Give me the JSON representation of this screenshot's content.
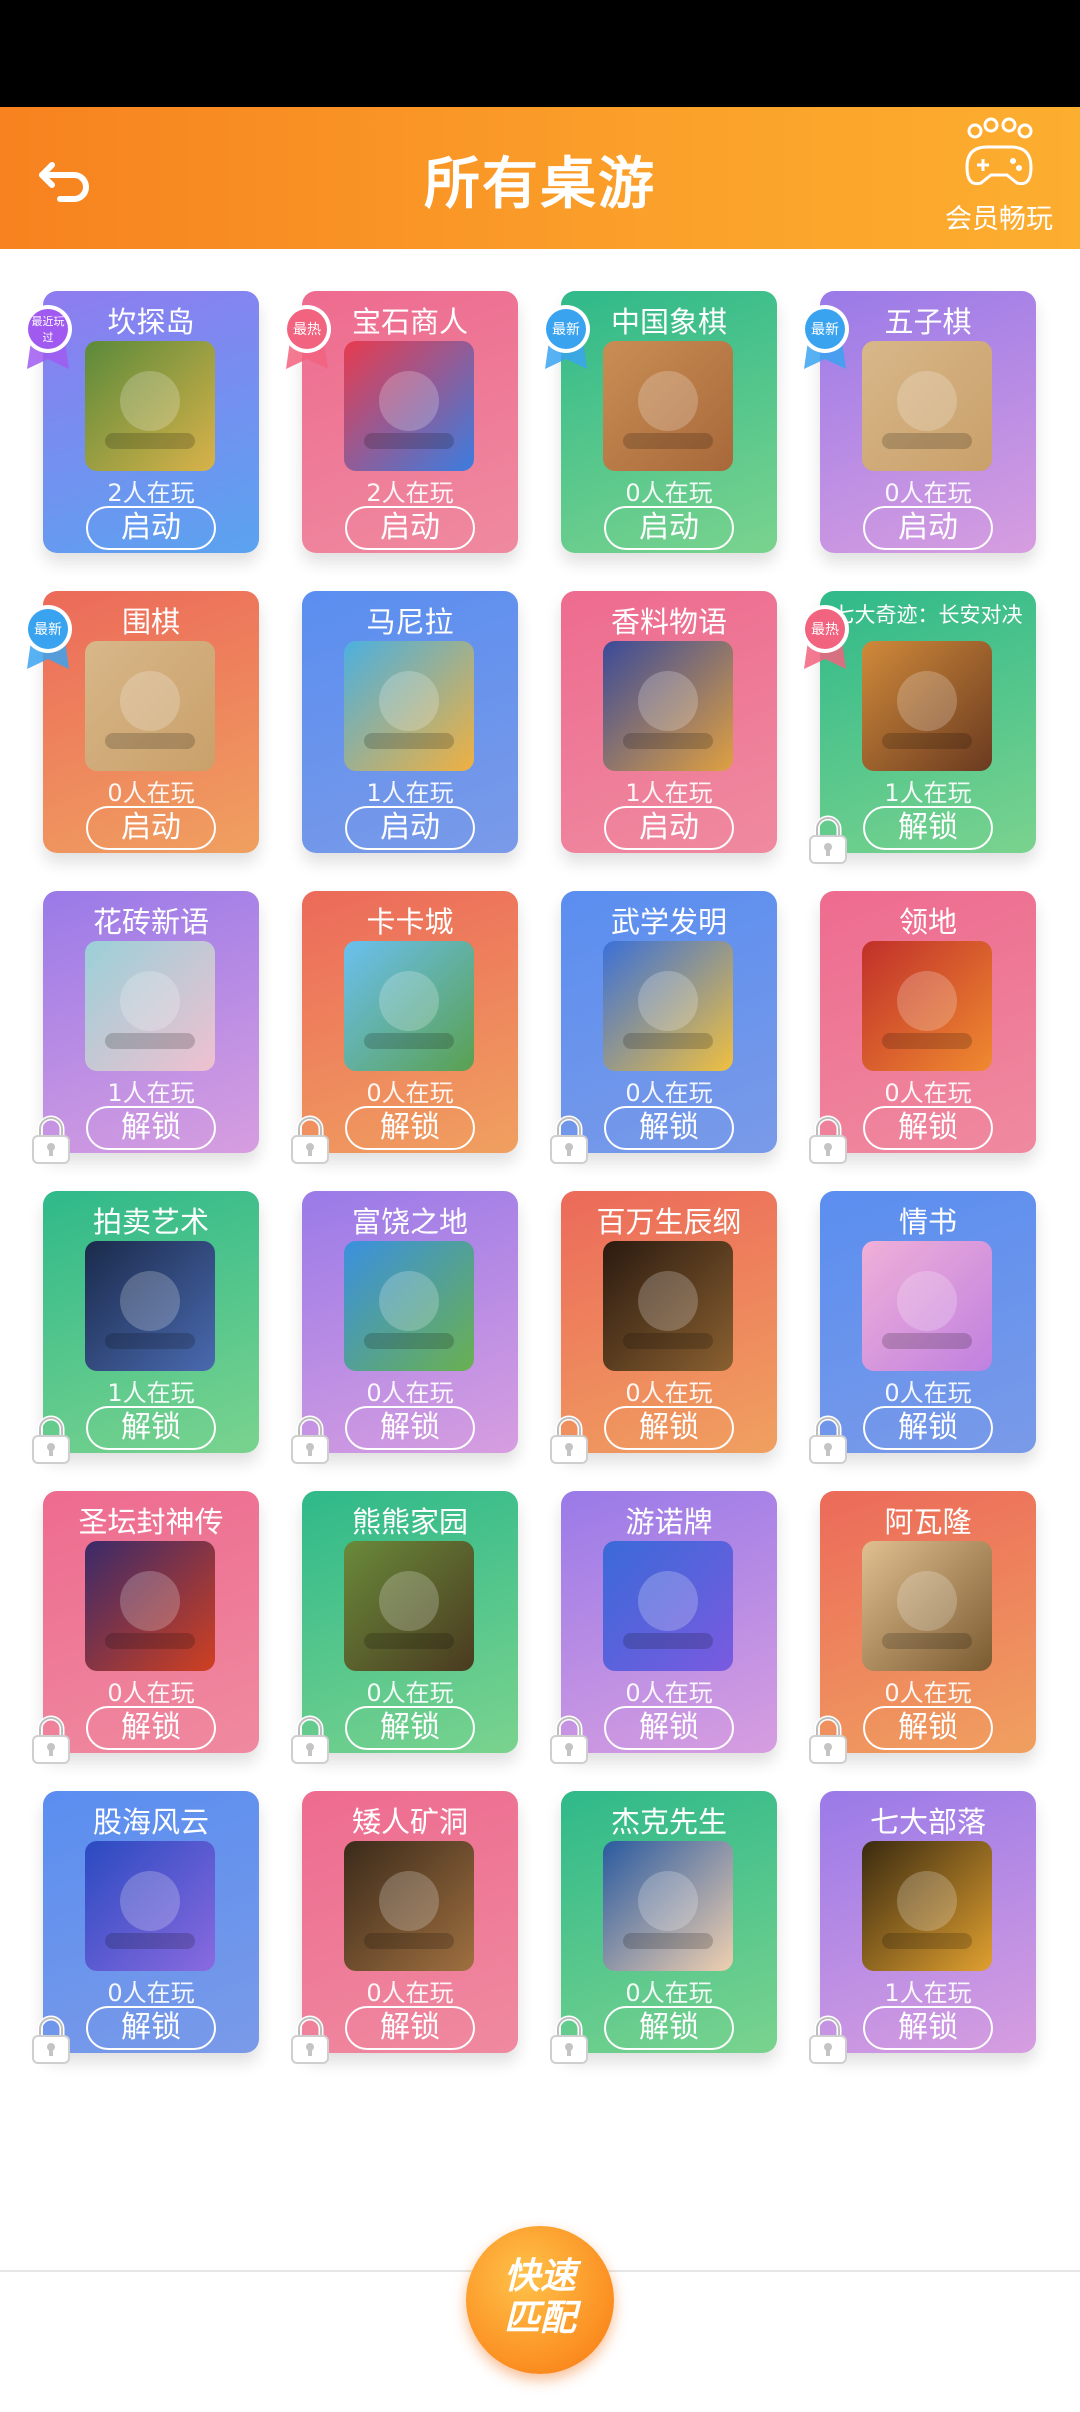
{
  "header": {
    "title": "所有桌游",
    "vip_label": "会员畅玩"
  },
  "bottom": {
    "match_line1": "快速",
    "match_line2": "匹配"
  },
  "games": [
    {
      "name": "坎探岛",
      "players": "2人在玩",
      "action": "启动",
      "badge": "最近玩过",
      "locked": false,
      "grad": [
        "#8f7cf0",
        "#5aa3f0"
      ],
      "icon": "kantan-island-icon",
      "iconbg": [
        "#5a8a3a",
        "#d9b24a"
      ]
    },
    {
      "name": "宝石商人",
      "players": "2人在玩",
      "action": "启动",
      "badge": "最热",
      "locked": false,
      "grad": [
        "#ee6b8f",
        "#ef8aa0"
      ],
      "icon": "gem-merchant-icon",
      "iconbg": [
        "#e83b4e",
        "#3a7de0"
      ]
    },
    {
      "name": "中国象棋",
      "players": "0人在玩",
      "action": "启动",
      "badge": "最新",
      "locked": false,
      "grad": [
        "#2fb98a",
        "#7ad38e"
      ],
      "icon": "chinese-chess-icon",
      "iconbg": [
        "#c98e54",
        "#a8683a"
      ]
    },
    {
      "name": "五子棋",
      "players": "0人在玩",
      "action": "启动",
      "badge": "最新",
      "locked": false,
      "grad": [
        "#9a7ae8",
        "#d79ee0"
      ],
      "icon": "gomoku-icon",
      "iconbg": [
        "#d8b789",
        "#c9a06a"
      ]
    },
    {
      "name": "围棋",
      "players": "0人在玩",
      "action": "启动",
      "badge": "最新",
      "locked": false,
      "grad": [
        "#ec6a5a",
        "#f0a060"
      ],
      "icon": "go-icon",
      "iconbg": [
        "#d8b789",
        "#c9a06a"
      ]
    },
    {
      "name": "马尼拉",
      "players": "1人在玩",
      "action": "启动",
      "badge": "",
      "locked": false,
      "grad": [
        "#5a8ef0",
        "#7a9ae8"
      ],
      "icon": "manila-icon",
      "iconbg": [
        "#4bb0e0",
        "#f0b040"
      ]
    },
    {
      "name": "香料物语",
      "players": "1人在玩",
      "action": "启动",
      "badge": "",
      "locked": false,
      "grad": [
        "#ee6b8f",
        "#ef8aa0"
      ],
      "icon": "spice-story-icon",
      "iconbg": [
        "#3a4a9a",
        "#e0a040"
      ]
    },
    {
      "name": "七大奇迹：长安对决",
      "players": "1人在玩",
      "action": "解锁",
      "badge": "最热",
      "locked": true,
      "grad": [
        "#2fb98a",
        "#7ad38e"
      ],
      "icon": "seven-wonders-icon",
      "iconbg": [
        "#d08a3a",
        "#6a3a20"
      ]
    },
    {
      "name": "花砖新语",
      "players": "1人在玩",
      "action": "解锁",
      "badge": "",
      "locked": true,
      "grad": [
        "#9a7ae8",
        "#d79ee0"
      ],
      "icon": "azul-icon",
      "iconbg": [
        "#9ad0d8",
        "#f0c0d0"
      ]
    },
    {
      "name": "卡卡城",
      "players": "0人在玩",
      "action": "解锁",
      "badge": "",
      "locked": true,
      "grad": [
        "#ec6a5a",
        "#f0a060"
      ],
      "icon": "carcassonne-icon",
      "iconbg": [
        "#6ac0f0",
        "#5aa050"
      ]
    },
    {
      "name": "武学发明",
      "players": "0人在玩",
      "action": "解锁",
      "badge": "",
      "locked": true,
      "grad": [
        "#5a8ef0",
        "#7a9ae8"
      ],
      "icon": "martial-invention-icon",
      "iconbg": [
        "#3a70d8",
        "#f0c040"
      ]
    },
    {
      "name": "领地",
      "players": "0人在玩",
      "action": "解锁",
      "badge": "",
      "locked": true,
      "grad": [
        "#ee6b8f",
        "#ef8aa0"
      ],
      "icon": "territory-icon",
      "iconbg": [
        "#c0302a",
        "#f08a30"
      ]
    },
    {
      "name": "拍卖艺术",
      "players": "1人在玩",
      "action": "解锁",
      "badge": "",
      "locked": true,
      "grad": [
        "#2fb98a",
        "#7ad38e"
      ],
      "icon": "auction-art-icon",
      "iconbg": [
        "#1a2a4a",
        "#4a6ab0"
      ]
    },
    {
      "name": "富饶之地",
      "players": "0人在玩",
      "action": "解锁",
      "badge": "",
      "locked": true,
      "grad": [
        "#9a7ae8",
        "#d79ee0"
      ],
      "icon": "fertile-land-icon",
      "iconbg": [
        "#3a90e0",
        "#6ab050"
      ]
    },
    {
      "name": "百万生辰纲",
      "players": "0人在玩",
      "action": "解锁",
      "badge": "",
      "locked": true,
      "grad": [
        "#ec6a5a",
        "#f0a060"
      ],
      "icon": "million-birthday-icon",
      "iconbg": [
        "#2a1a10",
        "#8a6030"
      ]
    },
    {
      "name": "情书",
      "players": "0人在玩",
      "action": "解锁",
      "badge": "",
      "locked": true,
      "grad": [
        "#5a8ef0",
        "#7a9ae8"
      ],
      "icon": "love-letter-icon",
      "iconbg": [
        "#f0b0d8",
        "#c080e0"
      ]
    },
    {
      "name": "圣坛封神传",
      "players": "0人在玩",
      "action": "解锁",
      "badge": "",
      "locked": true,
      "grad": [
        "#ee6b8f",
        "#ef8aa0"
      ],
      "icon": "altar-legend-icon",
      "iconbg": [
        "#3a2a6a",
        "#d04020"
      ]
    },
    {
      "name": "熊熊家园",
      "players": "0人在玩",
      "action": "解锁",
      "badge": "",
      "locked": true,
      "grad": [
        "#2fb98a",
        "#7ad38e"
      ],
      "icon": "bear-home-icon",
      "iconbg": [
        "#6a8a3a",
        "#4a3a20"
      ]
    },
    {
      "name": "游诺牌",
      "players": "0人在玩",
      "action": "解锁",
      "badge": "",
      "locked": true,
      "grad": [
        "#9a7ae8",
        "#d79ee0"
      ],
      "icon": "uno-cards-icon",
      "iconbg": [
        "#3a6ad8",
        "#7a5ae0"
      ]
    },
    {
      "name": "阿瓦隆",
      "players": "0人在玩",
      "action": "解锁",
      "badge": "",
      "locked": true,
      "grad": [
        "#ec6a5a",
        "#f0a060"
      ],
      "icon": "avalon-icon",
      "iconbg": [
        "#e0c090",
        "#7a5a30"
      ]
    },
    {
      "name": "股海风云",
      "players": "0人在玩",
      "action": "解锁",
      "badge": "",
      "locked": true,
      "grad": [
        "#5a8ef0",
        "#7a9ae8"
      ],
      "icon": "stock-market-icon",
      "iconbg": [
        "#2a4ac0",
        "#8a6ae0"
      ]
    },
    {
      "name": "矮人矿洞",
      "players": "0人在玩",
      "action": "解锁",
      "badge": "",
      "locked": true,
      "grad": [
        "#ee6b8f",
        "#ef8aa0"
      ],
      "icon": "dwarf-mine-icon",
      "iconbg": [
        "#3a2a1a",
        "#a07040"
      ]
    },
    {
      "name": "杰克先生",
      "players": "0人在玩",
      "action": "解锁",
      "badge": "",
      "locked": true,
      "grad": [
        "#2fb98a",
        "#7ad38e"
      ],
      "icon": "mr-jack-icon",
      "iconbg": [
        "#2a5aa0",
        "#f0d0b0"
      ]
    },
    {
      "name": "七大部落",
      "players": "1人在玩",
      "action": "解锁",
      "badge": "",
      "locked": true,
      "grad": [
        "#9a7ae8",
        "#d79ee0"
      ],
      "icon": "seven-tribes-icon",
      "iconbg": [
        "#3a2a10",
        "#e0a030"
      ]
    }
  ],
  "colors": {
    "header_start": "#f7821f",
    "header_end": "#fcae2f",
    "match_button": "#fb8a1e"
  }
}
